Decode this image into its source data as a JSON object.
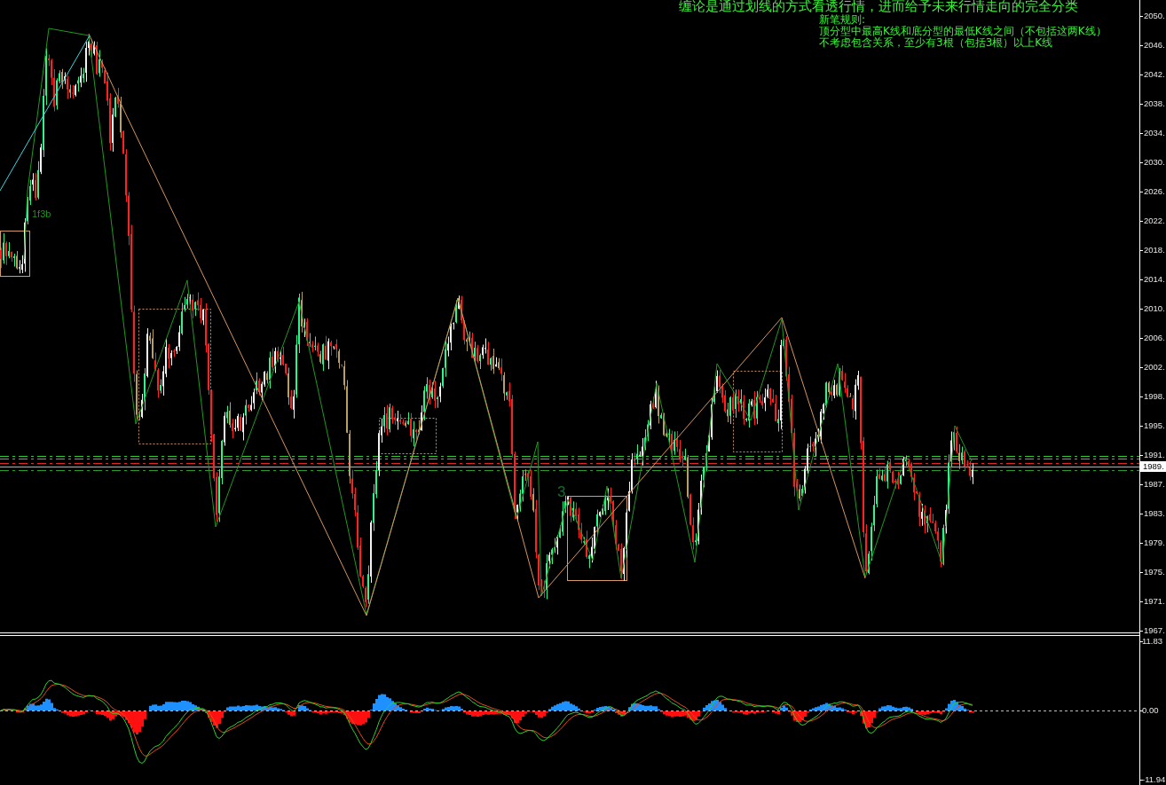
{
  "chart_title": "缠论是通过划线的方式看透行情，进而给予未来行情走向的完全分类",
  "rules_note": {
    "heading": "新笔规则:",
    "lines": [
      "顶分型中最高K线和底分型的最低K线之间（不包括这两K线）",
      "不考虑包含关系，至少有3根（包括3根）以上K线"
    ]
  },
  "price_pane": {
    "labels": [
      "1f3b",
      "3"
    ],
    "axis_labels": [
      "2050.",
      "2046.",
      "2042.",
      "2038.",
      "2034.",
      "2030.",
      "2026.",
      "2022.",
      "2018.",
      "2014.",
      "2010.",
      "2006.",
      "2002.",
      "1998.",
      "1995.",
      "1991.",
      "1987.",
      "1983.",
      "1979.",
      "1975.",
      "1971.",
      "1967."
    ],
    "current_price": "1989."
  },
  "indicator_pane": {
    "axis_labels": [
      "11.83",
      "0.00",
      "-11.94"
    ]
  }
}
